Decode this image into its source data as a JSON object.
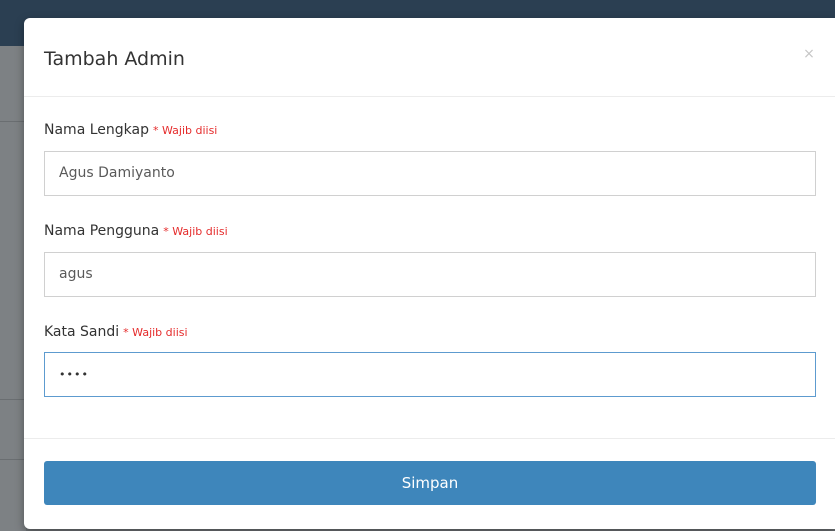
{
  "modal": {
    "title": "Tambah Admin",
    "close_icon": "close-icon",
    "close_glyph": "×"
  },
  "form": {
    "required_text": "* Wajib diisi",
    "fields": [
      {
        "label": "Nama Lengkap",
        "value": "Agus Damiyanto"
      },
      {
        "label": "Nama Pengguna",
        "value": "agus"
      },
      {
        "label": "Kata Sandi",
        "value": "••••"
      }
    ]
  },
  "footer": {
    "submit_label": "Simpan"
  },
  "colors": {
    "primary_button": "#3e86bb",
    "required": "#e52b2b",
    "focus_border": "#5d9bcf"
  }
}
